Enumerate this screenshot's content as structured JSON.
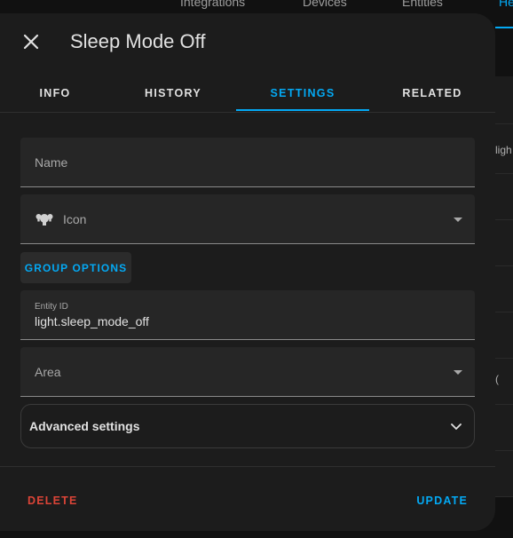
{
  "background": {
    "tabs": [
      "Integrations",
      "Devices",
      "Entities",
      "He"
    ],
    "side_text": [
      "ligh",
      "("
    ]
  },
  "dialog": {
    "title": "Sleep Mode Off",
    "tabs": [
      {
        "label": "INFO",
        "active": false
      },
      {
        "label": "HISTORY",
        "active": false
      },
      {
        "label": "SETTINGS",
        "active": true
      },
      {
        "label": "RELATED",
        "active": false
      }
    ],
    "fields": {
      "name": {
        "placeholder": "Name",
        "value": ""
      },
      "icon": {
        "label": "Icon",
        "icon": "lightbulb-group-icon"
      },
      "entity_id": {
        "label": "Entity ID",
        "value": "light.sleep_mode_off"
      },
      "area": {
        "label": "Area",
        "value": ""
      }
    },
    "group_options_label": "GROUP OPTIONS",
    "advanced_settings_label": "Advanced settings",
    "delete_label": "DELETE",
    "update_label": "UPDATE"
  },
  "colors": {
    "accent": "#03a9f4",
    "danger": "#db4437",
    "dialog_bg": "#1c1c1c",
    "field_bg": "#262626"
  }
}
